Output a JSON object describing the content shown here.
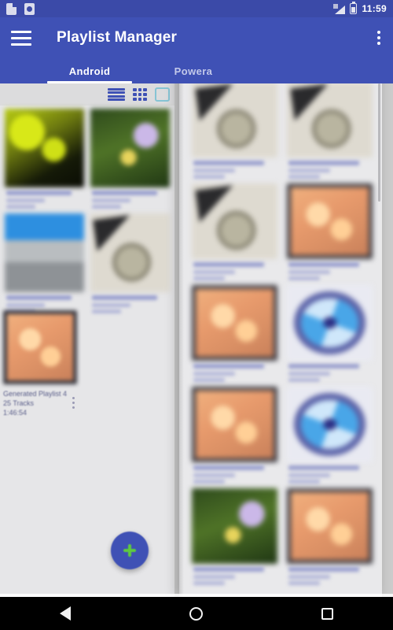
{
  "status_bar": {
    "time": "11:59",
    "icons_left": [
      "document-notification-icon",
      "download-notification-icon"
    ],
    "icons_right": [
      "signal-icon",
      "battery-icon"
    ]
  },
  "toolbar": {
    "menu_icon": "hamburger-menu-icon",
    "title": "Playlist Manager",
    "overflow_icon": "overflow-menu-icon",
    "background_color": "#3f51b5"
  },
  "tabs": [
    {
      "label": "Android",
      "selected": true
    },
    {
      "label": "Powera",
      "selected": false
    }
  ],
  "view_toggle": {
    "list_icon": "view-list-icon",
    "grid_icon": "view-grid-icon",
    "card_icon": "view-card-icon",
    "accent_color": "#3f51b5",
    "selected_outline_color": "#86c4d4"
  },
  "left_panel": {
    "grid_items": [
      {
        "art": "a-leaf"
      },
      {
        "art": "a-flower"
      },
      {
        "art": "a-city"
      },
      {
        "art": "a-key"
      }
    ],
    "list_item": {
      "title": "Generated Playlist 4",
      "tracks": "25 Tracks",
      "duration": "1:46:54",
      "overflow_icon": "list-item-overflow-icon"
    }
  },
  "fab": {
    "icon": "add-plus-icon",
    "background_color": "#3f51b5",
    "icon_color": "#5ecb3e"
  },
  "overlay_panel": {
    "grid_items": [
      {
        "art": "a-key"
      },
      {
        "art": "a-key"
      },
      {
        "art": "a-key"
      },
      {
        "art": "a-warm"
      },
      {
        "art": "a-warm"
      },
      {
        "art": "a-disc"
      },
      {
        "art": "a-warm"
      },
      {
        "art": "a-disc"
      },
      {
        "art": "a-flower"
      },
      {
        "art": "a-warm"
      }
    ]
  },
  "nav_bar": {
    "back_icon": "navigation-back-icon",
    "home_icon": "navigation-home-icon",
    "recents_icon": "navigation-recents-icon"
  }
}
